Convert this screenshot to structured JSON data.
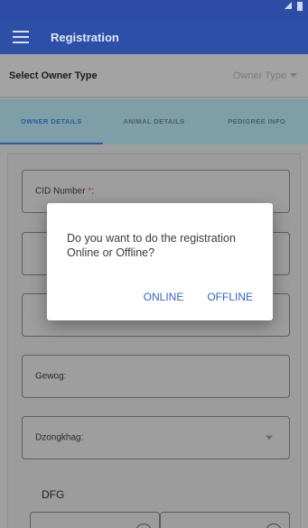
{
  "appbar": {
    "title": "Registration"
  },
  "owner": {
    "label": "Select Owner Type",
    "value": "Owner Type"
  },
  "tabs": [
    {
      "label": "OWNER DETAILS"
    },
    {
      "label": "ANIMAL DETAILS"
    },
    {
      "label": "PEDIGREE INFO"
    }
  ],
  "fields": {
    "cid": {
      "label": "CID Number",
      "required": "*",
      "suffix": ":"
    },
    "gewog": {
      "label": "Gewog:"
    },
    "dzongkhag": {
      "label": "Dzongkhag:"
    }
  },
  "section": {
    "dfg": "DFG"
  },
  "dialog": {
    "message": "Do you want to do the registration Online or Offline?",
    "online": "ONLINE",
    "offline": "OFFLINE"
  },
  "colors": {
    "primary": "#2c4fa8",
    "accent": "#2f66c9",
    "tab_bg": "#7e9ea8"
  }
}
